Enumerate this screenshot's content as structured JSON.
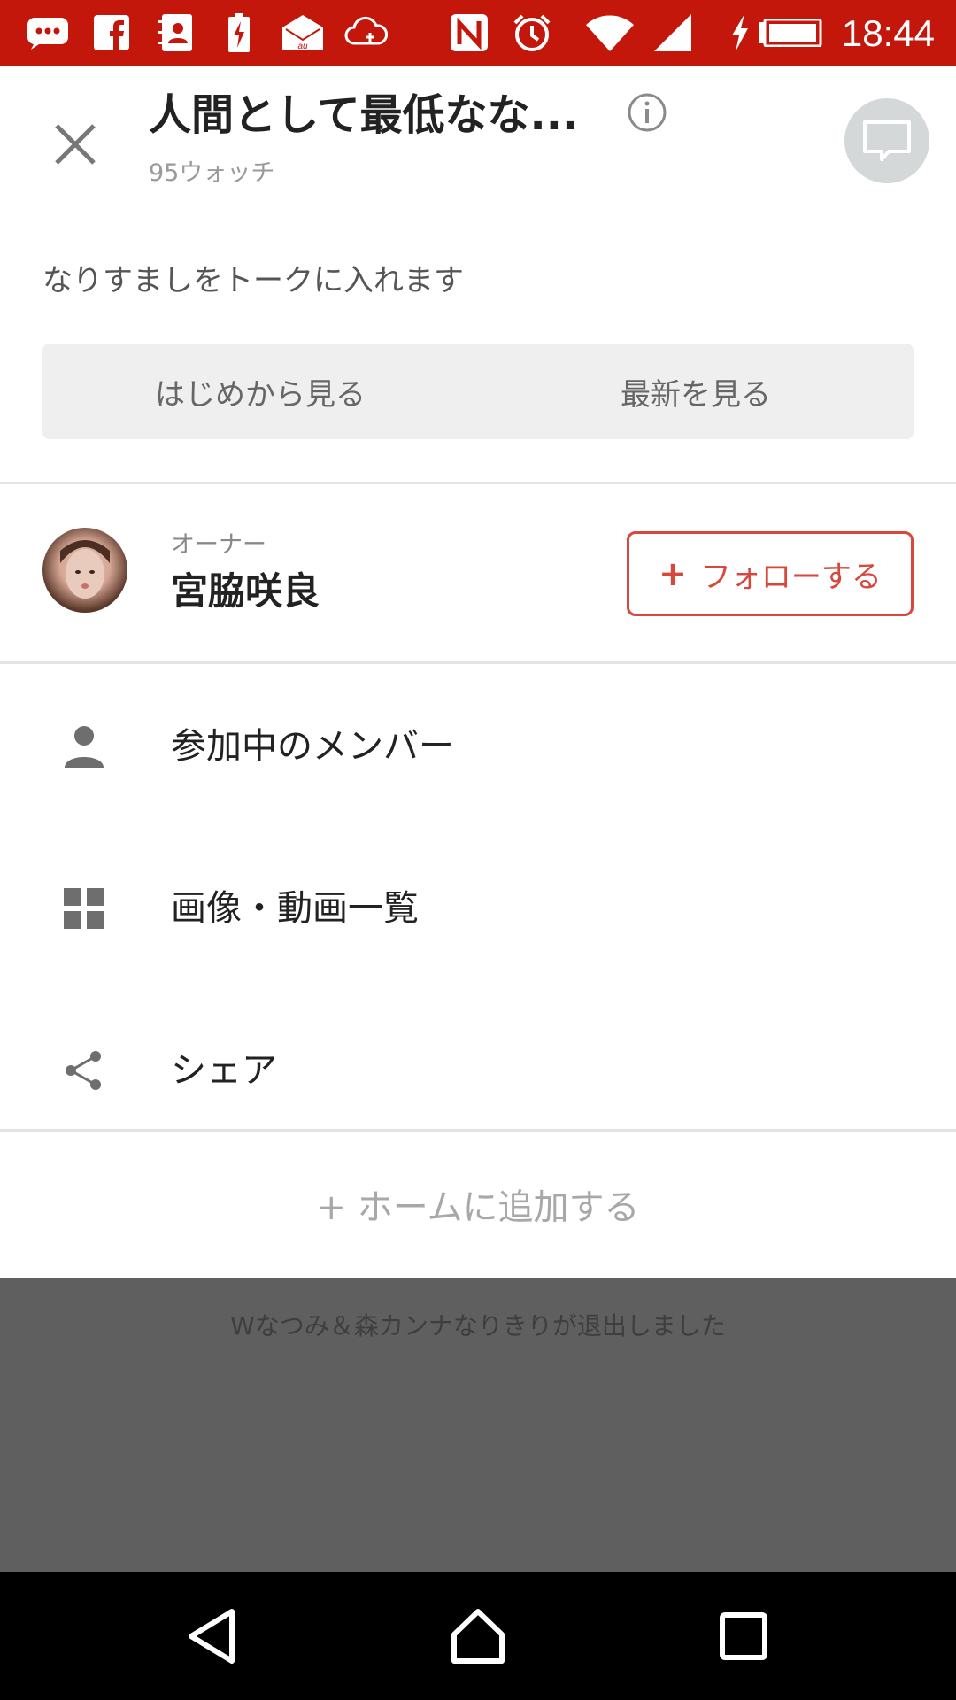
{
  "status_bar": {
    "time": "18:44",
    "icons": [
      "message-icon",
      "facebook-icon",
      "contacts-icon",
      "battery-saver-icon",
      "au-mail-icon",
      "cloud-icon",
      "nfc-icon",
      "alarm-icon",
      "wifi-icon",
      "signal-icon",
      "charging-icon",
      "battery-icon"
    ]
  },
  "header": {
    "title": "人間として最低なな...",
    "watch_count": "95ウォッチ"
  },
  "notice": "なりすましをトークに入れます",
  "segments": {
    "from_start": "はじめから見る",
    "latest": "最新を見る"
  },
  "owner": {
    "label": "オーナー",
    "name": "宮脇咲良",
    "follow_plus": "+",
    "follow_label": "フォローする"
  },
  "menu": {
    "members": "参加中のメンバー",
    "media": "画像・動画一覧",
    "share": "シェア"
  },
  "add_home": "+ ホームに追加する",
  "background_message": "Wなつみ＆森カンナなりきりが退出しました",
  "colors": {
    "status_bar": "#c4170c",
    "accent": "#d9463c",
    "dim_overlay": "#5f5f5f"
  }
}
